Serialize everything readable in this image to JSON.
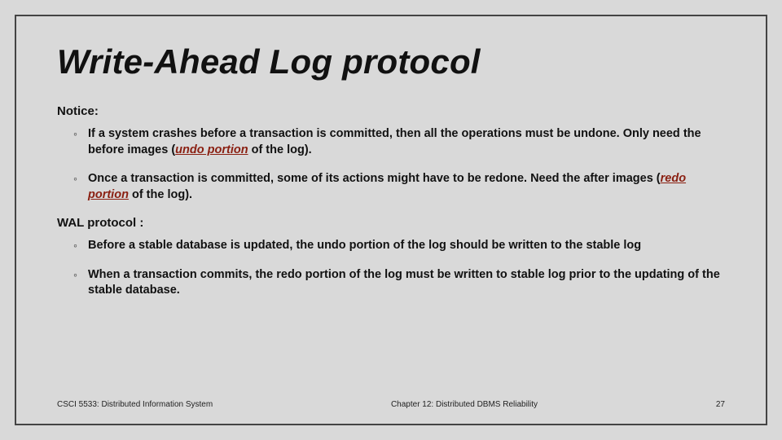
{
  "title": "Write-Ahead Log protocol",
  "sections": {
    "notice_label": "Notice:",
    "notice_items": [
      {
        "pre": "If a system crashes before a transaction is committed, then all the operations must be undone. Only need the before images (",
        "emph": "undo portion",
        "post": " of the log)."
      },
      {
        "pre": "Once a transaction is committed, some of its actions might have to be redone. Need the after images (",
        "emph": "redo portion",
        "post": " of the log)."
      }
    ],
    "wal_label": "WAL protocol :",
    "wal_items": [
      {
        "text": "Before a stable database is updated, the undo portion of the log should be written to the stable log"
      },
      {
        "text": "When a transaction commits,  the redo portion of the log must be written to stable log prior to the updating of the stable database."
      }
    ]
  },
  "footer": {
    "left": "CSCI 5533: Distributed Information System",
    "center": "Chapter 12: Distributed DBMS Reliability",
    "right": "27"
  }
}
